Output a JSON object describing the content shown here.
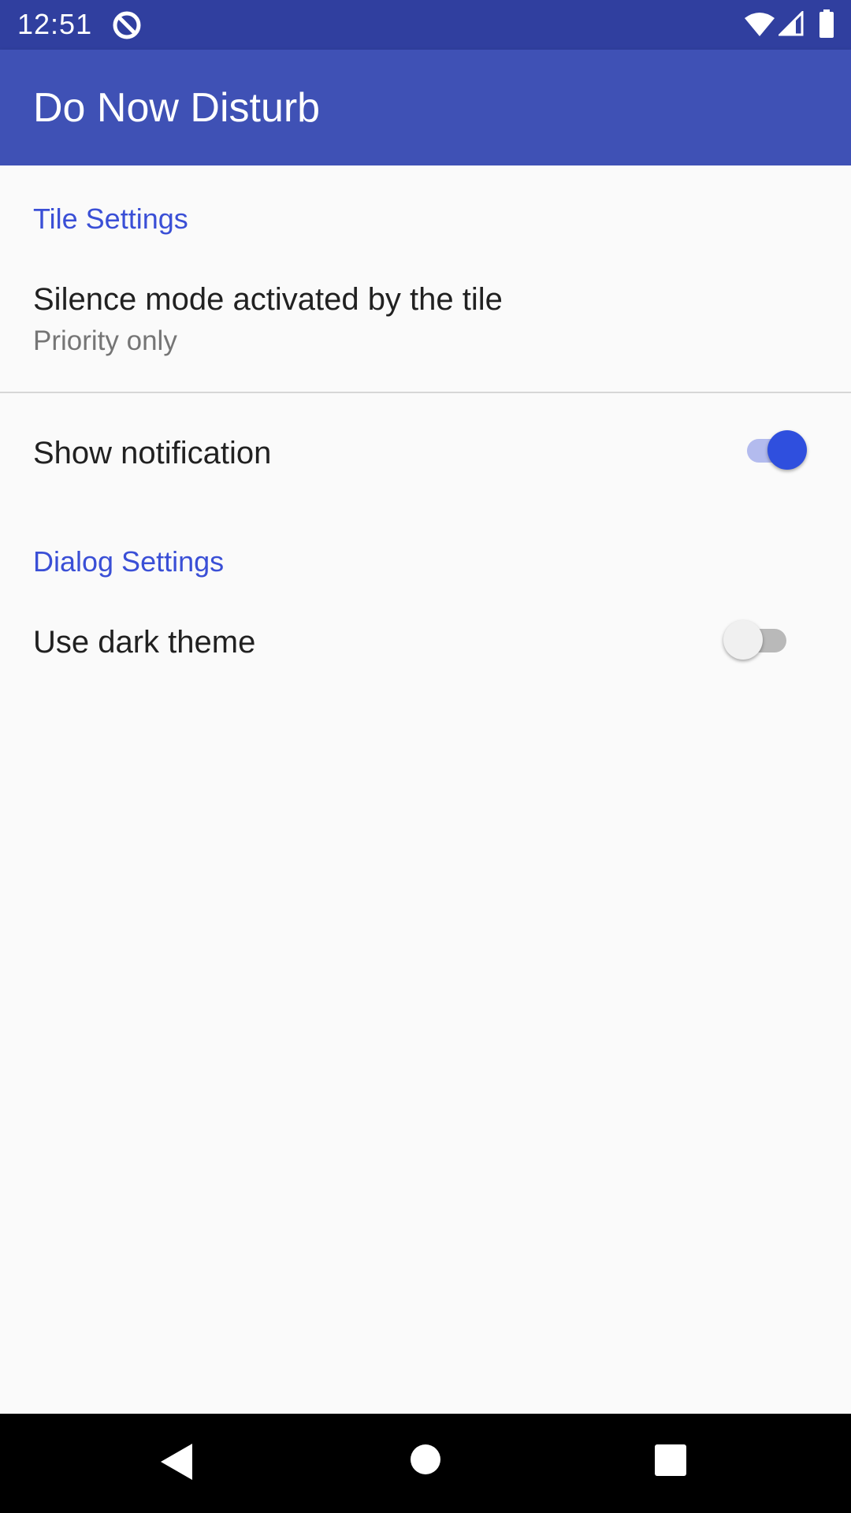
{
  "status_bar": {
    "time": "12:51",
    "icons": [
      "app-notification-icon",
      "wifi-icon",
      "cell-signal-icon",
      "battery-icon"
    ]
  },
  "app_bar": {
    "title": "Do Now Disturb"
  },
  "sections": {
    "tile": {
      "header": "Tile Settings",
      "silence_mode": {
        "title": "Silence mode activated by the tile",
        "summary": "Priority only"
      },
      "show_notification": {
        "title": "Show notification",
        "enabled": true
      }
    },
    "dialog": {
      "header": "Dialog Settings",
      "dark_theme": {
        "title": "Use dark theme",
        "enabled": false
      }
    }
  },
  "colors": {
    "status_bar": "#303f9f",
    "app_bar": "#3f51b5",
    "accent": "#3a4fd6",
    "switch_on_thumb": "#2f4fde",
    "switch_on_track": "#b3bbee",
    "background": "#fafafa"
  },
  "nav_bar": {
    "icons": [
      "back-icon",
      "home-icon",
      "recents-icon"
    ]
  }
}
